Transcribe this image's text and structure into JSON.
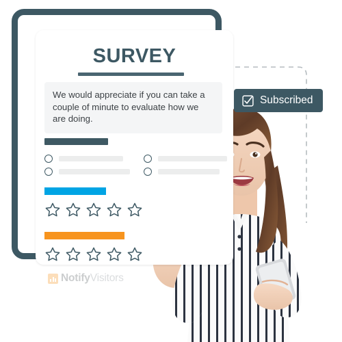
{
  "card": {
    "title": "SURVEY",
    "intro_text": "We would appreciate if you can take a couple of minute to evaluate how we are doing.",
    "question_heading_placeholder": "",
    "options": [
      {
        "column": "left",
        "label_placeholder": ""
      },
      {
        "column": "left",
        "label_placeholder": ""
      },
      {
        "column": "right",
        "label_placeholder": ""
      },
      {
        "column": "right",
        "label_placeholder": ""
      }
    ],
    "rating_groups": [
      {
        "bar_color": "#00a4e4",
        "stars": 5,
        "filled": 0
      },
      {
        "bar_color": "#f7941e",
        "stars": 5,
        "filled": 0
      }
    ],
    "frame_color": "#3d5863",
    "title_color": "#3d5863",
    "intro_bg": "#f4f5f6"
  },
  "watermark": {
    "brand_bold": "Notify",
    "brand_light": "Visitors",
    "icon": "bar-chart-icon",
    "icon_color": "#f7941e"
  },
  "badge": {
    "label": "Subscribed",
    "icon": "checkbox-checked-icon",
    "background": "#3d5863",
    "text_color": "#ffffff"
  },
  "connector": {
    "style": "dashed",
    "color": "#b5bcc0"
  },
  "person": {
    "description": "smiling young woman pointing upward holding a smartphone",
    "shirt": "white with navy vertical stripes",
    "hair_color": "#6b4532"
  }
}
